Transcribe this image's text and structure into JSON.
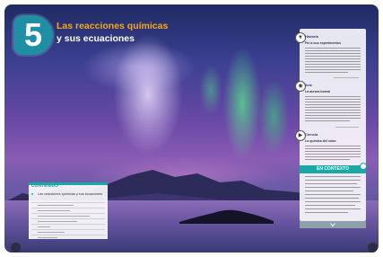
{
  "chapter": {
    "number": "5",
    "title": "Las reacciones químicas",
    "subtitle": "y sus ecuaciones"
  },
  "info_panel": {
    "sections": [
      {
        "tab": "Historia",
        "heading": "Fin a sus experimentos"
      },
      {
        "tab": "Arte",
        "heading": "La aurora boreal"
      },
      {
        "tab": "Ciencia",
        "heading": "La química del color"
      }
    ],
    "context_label": "EN CONTEXTO"
  },
  "contents": {
    "title": "CONTENIDO",
    "first_item": "Las reacciones químicas y sus ecuaciones"
  }
}
